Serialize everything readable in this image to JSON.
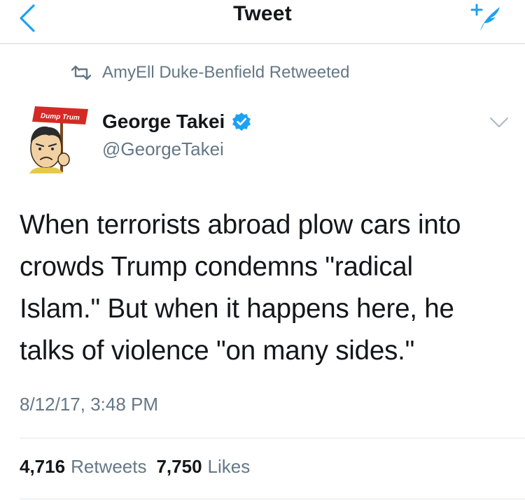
{
  "nav": {
    "title": "Tweet",
    "back_icon": "chevron-left-icon",
    "compose_icon": "compose-tweet-icon"
  },
  "retweet_context": {
    "text": "AmyEll Duke-Benfield Retweeted",
    "icon": "retweet-icon"
  },
  "author": {
    "display_name": "George Takei",
    "screen_name": "@GeorgeTakei",
    "verified": true,
    "avatar_sign_text": "Dump Trum"
  },
  "tweet": {
    "lines": [
      "When terrorists abroad plow cars into",
      "crowds Trump condemns \"radical",
      "Islam.\" But when it happens here, he",
      "talks of violence \"on many sides.\""
    ],
    "timestamp": "8/12/17, 3:48 PM"
  },
  "stats": {
    "retweets_count": "4,716",
    "retweets_label": "Retweets",
    "likes_count": "7,750",
    "likes_label": "Likes"
  },
  "colors": {
    "accent": "#1da1f2",
    "secondary_text": "#657786",
    "primary_text": "#14171a"
  }
}
